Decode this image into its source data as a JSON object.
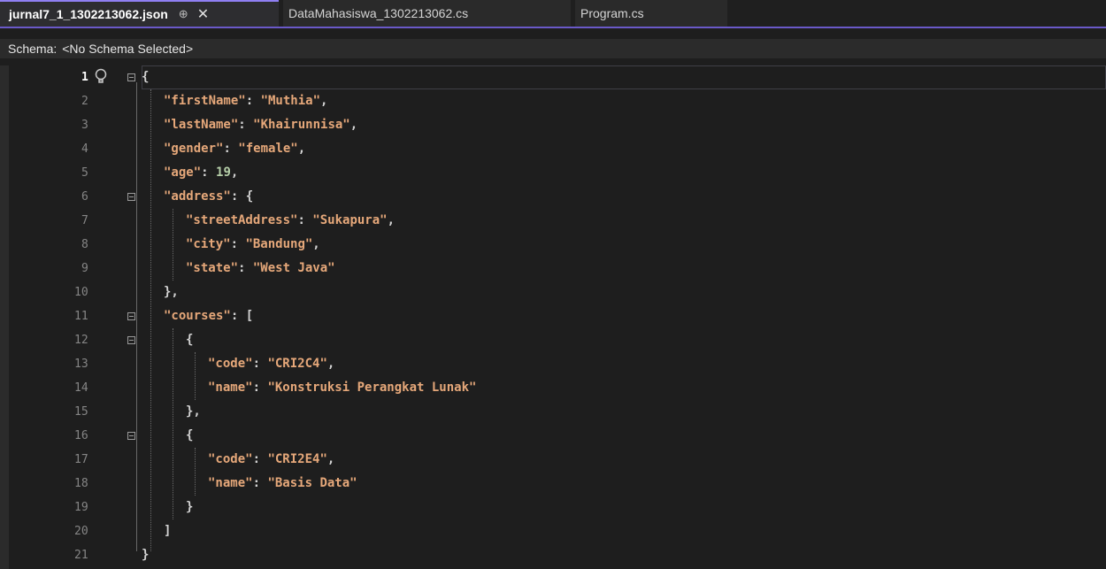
{
  "tabs": [
    {
      "label": "jurnal7_1_1302213062.json",
      "pin": "⊕",
      "close": "✕",
      "active": true
    },
    {
      "label": "DataMahasiswa_1302213062.cs",
      "active": false
    },
    {
      "label": "Program.cs",
      "active": false
    }
  ],
  "schema": {
    "label": "Schema:",
    "value": "<No Schema Selected>"
  },
  "editor": {
    "current_line": 1,
    "line_numbers": [
      "1",
      "2",
      "3",
      "4",
      "5",
      "6",
      "7",
      "8",
      "9",
      "10",
      "11",
      "12",
      "13",
      "14",
      "15",
      "16",
      "17",
      "18",
      "19",
      "20",
      "21"
    ]
  },
  "colors": {
    "accent": "#8f7ff2",
    "key": "#e6a87a",
    "number": "#b5cea8",
    "linenumber": "#858585"
  },
  "icons": {
    "lightbulb": "lightbulb-icon",
    "pin": "pin-icon",
    "close": "close-icon"
  }
}
